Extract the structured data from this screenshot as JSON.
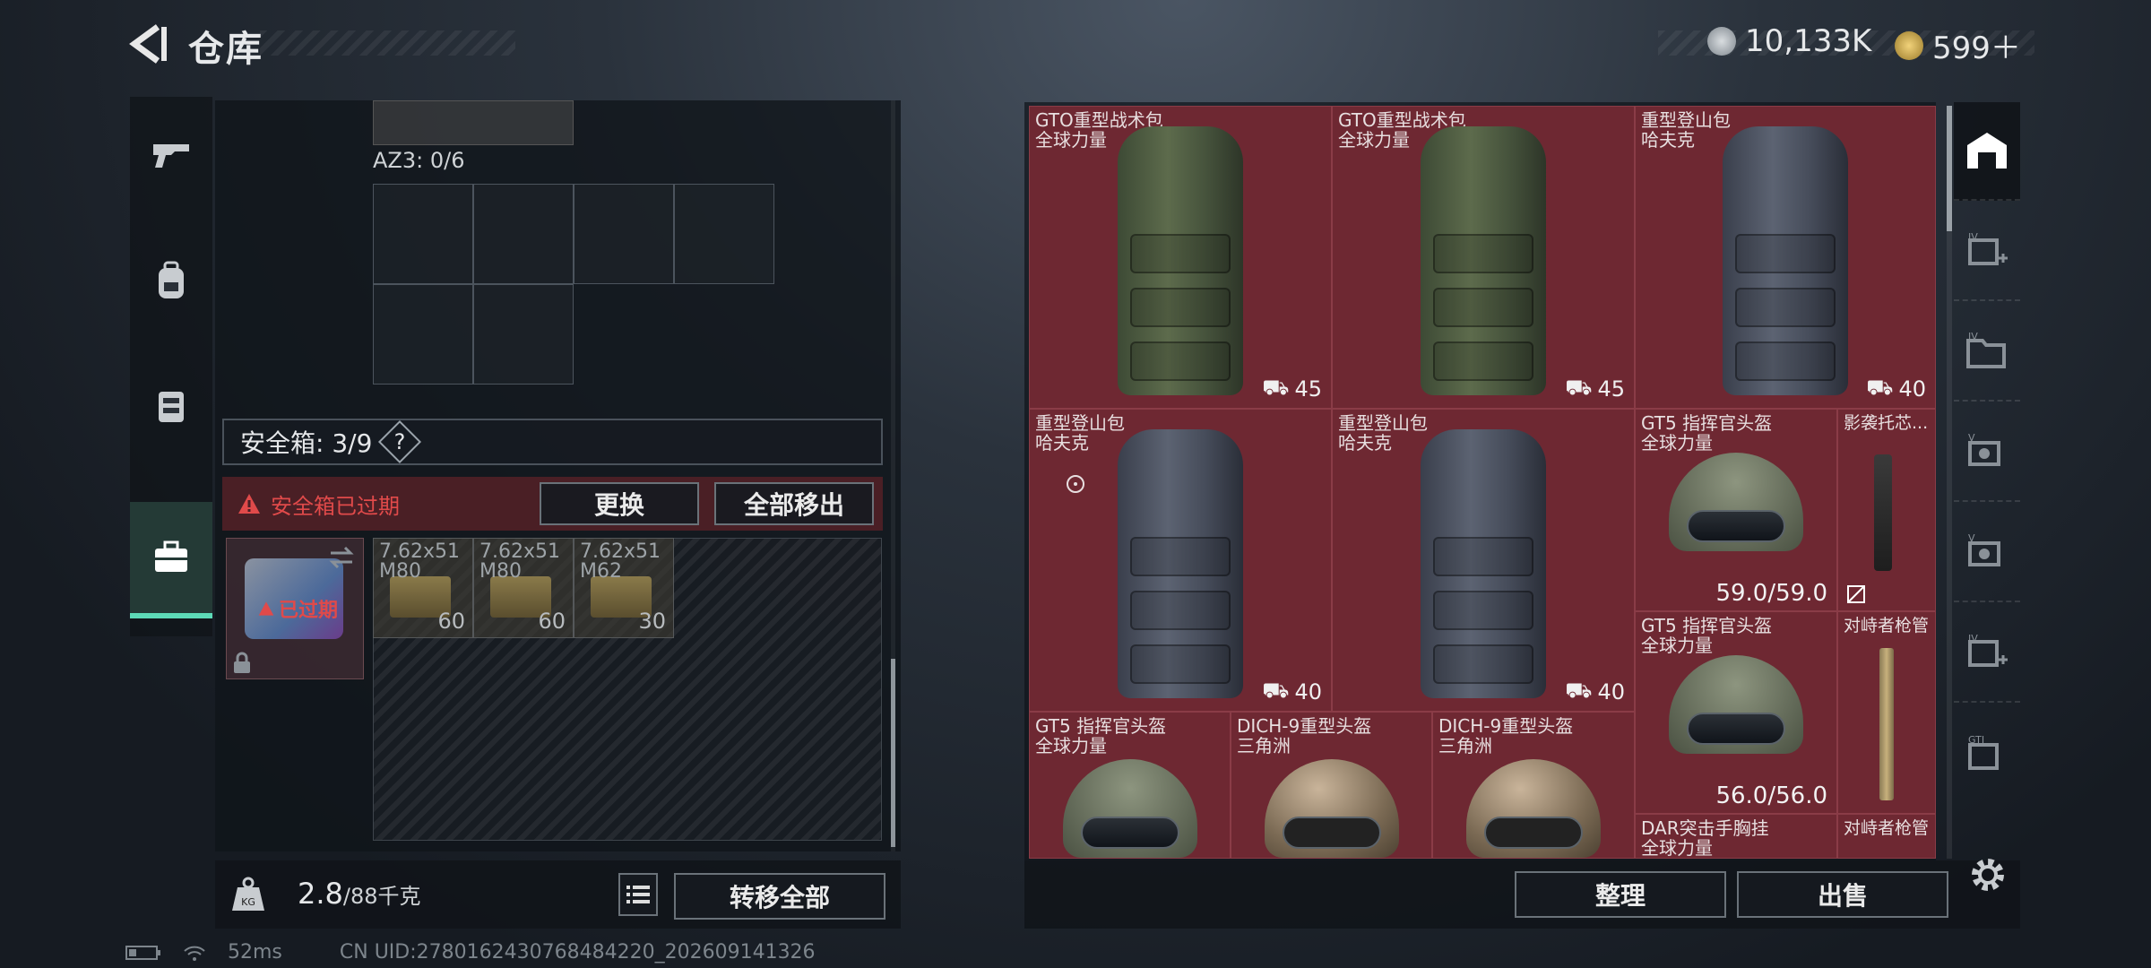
{
  "header": {
    "title": "仓库",
    "currency1": "10,133K",
    "currency2": "599＋"
  },
  "left_nav": [
    "weapons",
    "backpack",
    "chest-rig",
    "safe-box"
  ],
  "container": {
    "az3_label": "AZ3: 0/6"
  },
  "safebox": {
    "label": "安全箱: 3/9",
    "help": "?",
    "expired_text": "安全箱已过期",
    "item_badge": "已过期",
    "replace_btn": "更换",
    "move_all_btn": "全部移出"
  },
  "ammo": [
    {
      "name": "7.62x51",
      "sub": "M80",
      "count": "60"
    },
    {
      "name": "7.62x51",
      "sub": "M80",
      "count": "60"
    },
    {
      "name": "7.62x51",
      "sub": "M62",
      "count": "30"
    }
  ],
  "weight": {
    "current": "2.8",
    "max": "/88千克"
  },
  "transfer_btn": "转移全部",
  "stash_items": [
    {
      "name": "GTO重型战术包",
      "brand": "全球力量",
      "weight": "45"
    },
    {
      "name": "GTO重型战术包",
      "brand": "全球力量",
      "weight": "45"
    },
    {
      "name": "重型登山包",
      "brand": "哈夫克",
      "weight": "40"
    },
    {
      "name": "重型登山包",
      "brand": "哈夫克",
      "weight": "40"
    },
    {
      "name": "重型登山包",
      "brand": "哈夫克",
      "weight": "40"
    },
    {
      "name": "GT5 指挥官头盔",
      "brand": "全球力量",
      "durability": "59.0/59.0"
    },
    {
      "name": "影袭托芯...",
      "brand": ""
    },
    {
      "name": "GT5 指挥官头盔",
      "brand": "全球力量",
      "durability": "56.0/56.0"
    },
    {
      "name": "对峙者枪管",
      "brand": ""
    },
    {
      "name": "GT5 指挥官头盔",
      "brand": "全球力量"
    },
    {
      "name": "DICH-9重型头盔",
      "brand": "三角洲"
    },
    {
      "name": "DICH-9重型头盔",
      "brand": "三角洲"
    },
    {
      "name": "DAR突击手胸挂",
      "brand": "全球力量"
    },
    {
      "name": "对峙者枪管",
      "brand": ""
    }
  ],
  "stash_buttons": {
    "sort": "整理",
    "sell": "出售"
  },
  "status": {
    "ping": "52ms",
    "uid": "CN UID:2780162430768484220_202609141326"
  },
  "colors": {
    "accent": "#5ddab7",
    "stash_bg": "#6b2731",
    "expired": "#e04a4a"
  }
}
